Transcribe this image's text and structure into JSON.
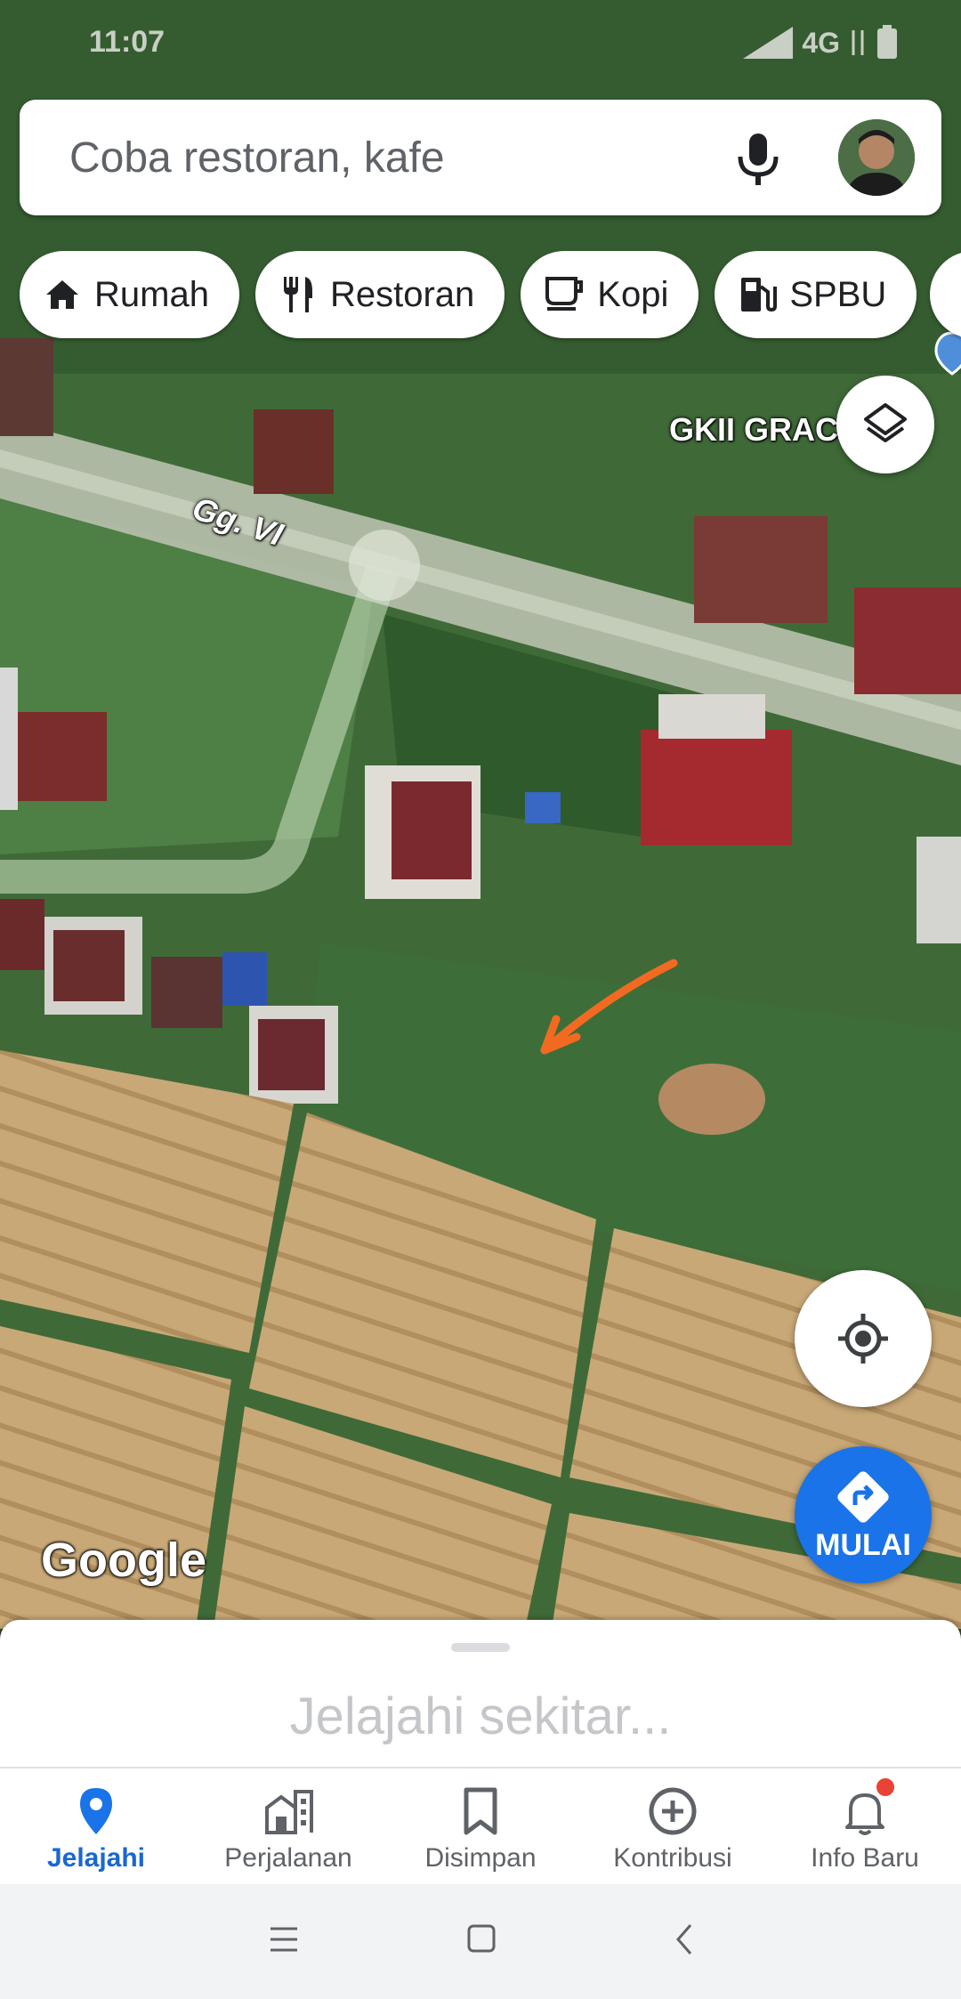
{
  "status": {
    "time": "11:07",
    "network": "4G"
  },
  "search": {
    "placeholder": "Coba restoran, kafe"
  },
  "chips": [
    {
      "label": "Rumah",
      "icon": "home-icon"
    },
    {
      "label": "Restoran",
      "icon": "restaurant-icon"
    },
    {
      "label": "Kopi",
      "icon": "coffee-icon"
    },
    {
      "label": "SPBU",
      "icon": "gas-station-icon"
    }
  ],
  "map": {
    "street_label": "Gg. VI",
    "poi_label": "GKII GRACE",
    "logo": "Google",
    "accent": "#1a73e8",
    "arrow_color": "#f26a21"
  },
  "actions": {
    "start_label": "MULAI"
  },
  "sheet": {
    "title": "Jelajahi sekitar..."
  },
  "nav": {
    "explore": "Jelajahi",
    "commute": "Perjalanan",
    "saved": "Disimpan",
    "contribute": "Kontribusi",
    "updates": "Info Baru"
  }
}
